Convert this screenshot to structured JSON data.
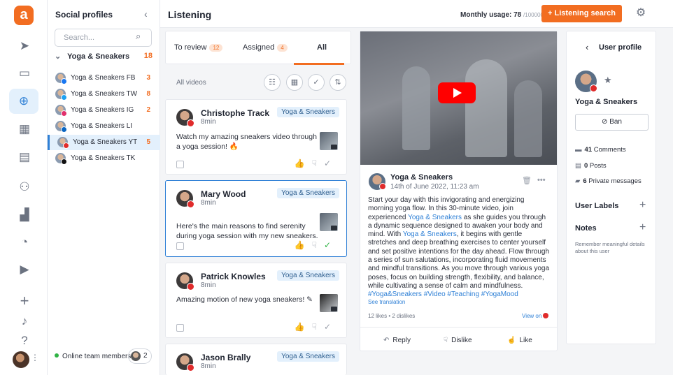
{
  "rail": {
    "logo": "a",
    "icons": [
      "send-icon",
      "inbox-icon",
      "listening-icon",
      "calendar-icon",
      "planner-icon",
      "team-icon",
      "reports-icon",
      "dashboard-icon",
      "media-icon",
      "add-icon",
      "bell-icon",
      "help-icon"
    ]
  },
  "profiles": {
    "title": "Social profiles",
    "search_placeholder": "Search...",
    "group": {
      "name": "Yoga & Sneakers",
      "count": "18"
    },
    "items": [
      {
        "name": "Yoga & Sneakers FB",
        "count": "3",
        "network": "facebook",
        "color": "#1877f2"
      },
      {
        "name": "Yoga & Sneakers TW",
        "count": "8",
        "network": "twitter",
        "color": "#1da1f2"
      },
      {
        "name": "Yoga & Sneakers IG",
        "count": "2",
        "network": "instagram",
        "color": "#e1306c"
      },
      {
        "name": "Yoga & Sneakers LI",
        "count": "",
        "network": "linkedin",
        "color": "#0a66c2"
      },
      {
        "name": "Yoga & Sneakers YT",
        "count": "5",
        "network": "youtube",
        "color": "#e02b2b"
      },
      {
        "name": "Yoga & Sneakers TK",
        "count": "",
        "network": "tiktok",
        "color": "#111111"
      }
    ],
    "online_label": "Online team members",
    "online_count": "2"
  },
  "topbar": {
    "title": "Listening",
    "usage_label": "Monthly usage: ",
    "usage_value": "78",
    "usage_limit": "/100000",
    "cta": "+ Listening search"
  },
  "tabs": [
    {
      "label": "To review",
      "badge": "12"
    },
    {
      "label": "Assigned",
      "badge": "4"
    },
    {
      "label": "All",
      "badge": ""
    }
  ],
  "list": {
    "filter_label": "All videos",
    "cards": [
      {
        "name": "Christophe Track",
        "time": "8min",
        "tag": "Yoga & Sneakers",
        "text": "Watch my amazing sneakers video through a yoga session! 🔥",
        "liked": true,
        "approved": false
      },
      {
        "name": "Mary Wood",
        "time": "8min",
        "tag": "Yoga & Sneakers",
        "text": "Here's the main reasons to find serenity during yoga session with my new sneakers.",
        "liked": true,
        "approved": true
      },
      {
        "name": "Patrick Knowles",
        "time": "8min",
        "tag": "Yoga & Sneakers",
        "text": "Amazing motion of new yoga sneakers! ✎",
        "liked": false,
        "approved": false
      },
      {
        "name": "Jason Brally",
        "time": "8min",
        "tag": "Yoga & Sneakers",
        "text": "",
        "liked": false,
        "approved": false
      }
    ]
  },
  "post": {
    "author": "Yoga & Sneakers",
    "date": "14th of June 2022, 11:23 am",
    "body_1": "Start your day with this invigorating and energizing morning yoga flow. In this 30-minute video, join experienced ",
    "link_1": "Yoga & Sneakers",
    "body_2": " as she guides you through a dynamic sequence designed to awaken your body and mind. With ",
    "link_2": "Yoga & Sneakers",
    "body_3": ", it begins with gentle stretches and deep breathing exercises to center yourself and set positive intentions for the day ahead. Flow through a series of sun salutations, incorporating fluid movements and mindful transitions. As you move through various yoga poses, focus on building strength, flexibility, and balance, while cultivating a sense of calm and mindfulness. ",
    "hashtags": "#Yoga&Sneakers #Video #Teaching #YogaMood",
    "see_translation": "See translation",
    "stats": "12 likes • 2 dislikes",
    "view_on": "View on",
    "actions": {
      "reply": "Reply",
      "dislike": "Dislike",
      "like": "Like"
    }
  },
  "user_profile": {
    "title": "User profile",
    "name": "Yoga & Sneakers",
    "ban": "Ban",
    "comments_value": "41",
    "comments_label": " Comments",
    "posts_value": "0",
    "posts_label": " Posts",
    "pm_value": "6",
    "pm_label": " Private messages",
    "labels_title": "User Labels",
    "notes_title": "Notes",
    "notes_hint": "Remember meaningful details about this user"
  },
  "colors": {
    "accent": "#f26d21",
    "link": "#2f80d6",
    "success": "#2fb344",
    "youtube": "#e02b2b"
  }
}
